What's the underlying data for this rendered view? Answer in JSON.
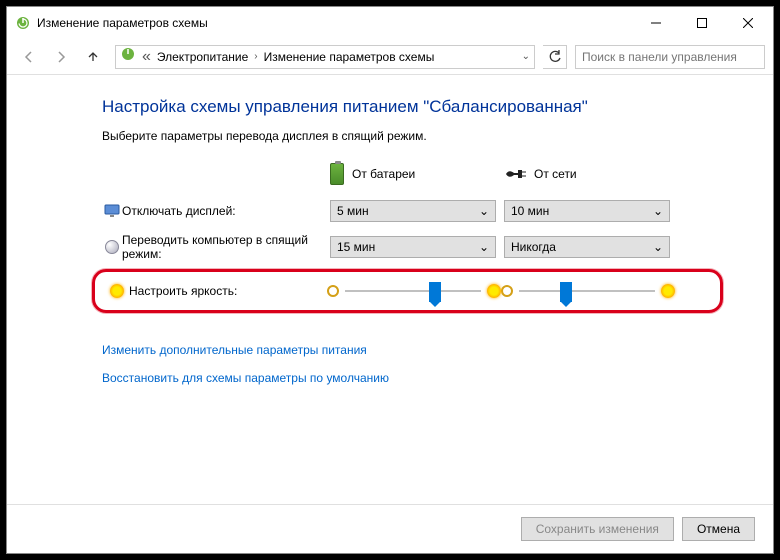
{
  "window": {
    "title": "Изменение параметров схемы"
  },
  "breadcrumb": {
    "root": "Электропитание",
    "current": "Изменение параметров схемы"
  },
  "search": {
    "placeholder": "Поиск в панели управления"
  },
  "page": {
    "heading": "Настройка схемы управления питанием \"Сбалансированная\"",
    "subheading": "Выберите параметры перевода дисплея в спящий режим."
  },
  "modes": {
    "battery": "От батареи",
    "ac": "От сети"
  },
  "rows": {
    "display_off": {
      "label": "Отключать дисплей:",
      "battery_value": "5 мин",
      "ac_value": "10 мин"
    },
    "sleep": {
      "label": "Переводить компьютер в спящий режим:",
      "battery_value": "15 мин",
      "ac_value": "Никогда"
    },
    "brightness": {
      "label": "Настроить яркость:"
    }
  },
  "links": {
    "advanced": "Изменить дополнительные параметры питания",
    "restore_defaults": "Восстановить для схемы параметры по умолчанию"
  },
  "buttons": {
    "save": "Сохранить изменения",
    "cancel": "Отмена"
  }
}
